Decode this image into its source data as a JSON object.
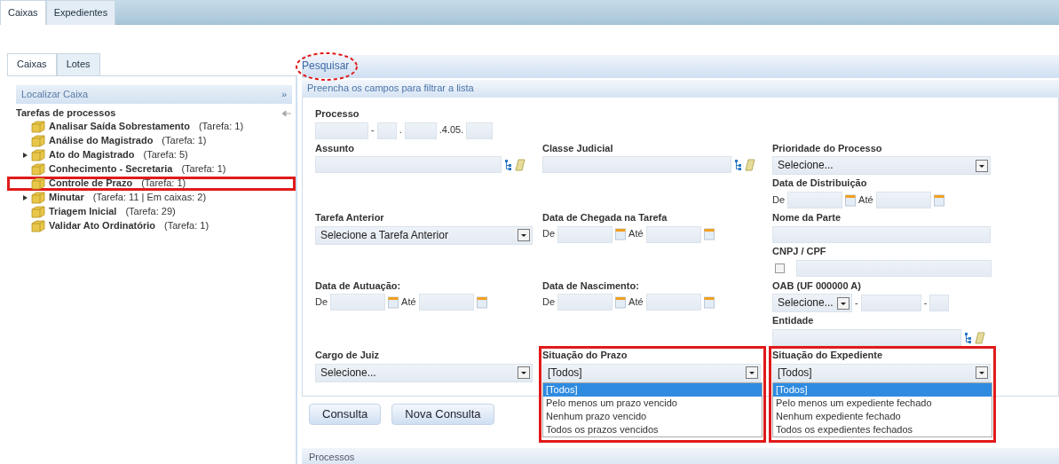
{
  "top_tabs": [
    {
      "label": "Caixas",
      "selected": true
    },
    {
      "label": "Expedientes",
      "selected": false
    }
  ],
  "sidebar": {
    "tabs": [
      {
        "label": "Caixas",
        "selected": true
      },
      {
        "label": "Lotes",
        "selected": false
      }
    ],
    "search_bar": {
      "label": "Localizar Caixa",
      "chevron": "»"
    },
    "tree": {
      "title": "Tarefas de processos",
      "items": [
        {
          "name": "Analisar Saída Sobrestamento",
          "count": "(Tarefa: 1)",
          "expandable": false,
          "highlighted": false
        },
        {
          "name": "Análise do Magistrado",
          "count": "(Tarefa: 1)",
          "expandable": false,
          "highlighted": false
        },
        {
          "name": "Ato do Magistrado",
          "count": "(Tarefa: 5)",
          "expandable": true,
          "highlighted": false
        },
        {
          "name": "Conhecimento - Secretaria",
          "count": "(Tarefa: 1)",
          "expandable": false,
          "highlighted": false
        },
        {
          "name": "Controle de Prazo",
          "count": "(Tarefa: 1)",
          "expandable": false,
          "highlighted": true
        },
        {
          "name": "Minutar",
          "count": "(Tarefa: 11 | Em caixas: 2)",
          "expandable": true,
          "highlighted": false
        },
        {
          "name": "Triagem Inicial",
          "count": "(Tarefa: 29)",
          "expandable": false,
          "highlighted": false
        },
        {
          "name": "Validar Ato Ordinatório",
          "count": "(Tarefa: 1)",
          "expandable": false,
          "highlighted": false
        }
      ]
    }
  },
  "search": {
    "title": "Pesquisar",
    "circled": true,
    "subtitle": "Preencha os campos para filtrar a lista",
    "rows": [
      [
        [
          {
            "kind": "processo",
            "label": "Processo",
            "separators": [
              "-",
              ".",
              ".4.05."
            ],
            "highlighted": false
          }
        ],
        [],
        []
      ],
      [
        [
          {
            "kind": "lookup",
            "label": "Assunto",
            "highlighted": false
          }
        ],
        [
          {
            "kind": "lookup",
            "label": "Classe Judicial",
            "highlighted": false
          }
        ],
        [
          {
            "kind": "select",
            "label": "Prioridade do Processo",
            "value": "Selecione...",
            "highlighted": false
          },
          {
            "kind": "daterange",
            "label": "Data de Distribuição",
            "from": "De",
            "to": "Até",
            "highlighted": false
          }
        ]
      ],
      [
        [
          {
            "kind": "select",
            "label": "Tarefa Anterior",
            "value": "Selecione a Tarefa Anterior",
            "highlighted": false
          }
        ],
        [
          {
            "kind": "daterange",
            "label": "Data de Chegada na Tarefa",
            "from": "De",
            "to": "Até",
            "highlighted": false
          }
        ],
        [
          {
            "kind": "text",
            "label": "Nome da Parte",
            "highlighted": false
          },
          {
            "kind": "cnpj",
            "label": "CNPJ / CPF",
            "checked": false,
            "highlighted": false
          }
        ]
      ],
      [
        [
          {
            "kind": "daterange",
            "label": "Data de Autuação:",
            "from": "De",
            "to": "Até",
            "highlighted": false
          }
        ],
        [
          {
            "kind": "daterange",
            "label": "Data de Nascimento:",
            "from": "De",
            "to": "Até",
            "highlighted": false
          }
        ],
        [
          {
            "kind": "oab",
            "label": "OAB (UF 000000 A)",
            "value": "Selecione...",
            "separators": [
              "-",
              "-"
            ],
            "highlighted": false
          },
          {
            "kind": "lookup",
            "label": "Entidade",
            "highlighted": false
          }
        ]
      ],
      [
        [
          {
            "kind": "select",
            "label": "Cargo de Juiz",
            "value": "Selecione...",
            "highlighted": false
          }
        ],
        [
          {
            "kind": "select",
            "label": "Situação do Prazo",
            "value": "[Todos]",
            "highlighted": true,
            "options": [
              {
                "label": "[Todos]",
                "selected": true
              },
              {
                "label": "Pelo menos um prazo vencido",
                "selected": false
              },
              {
                "label": "Nenhum prazo vencido",
                "selected": false
              },
              {
                "label": "Todos os prazos vencidos",
                "selected": false
              }
            ]
          }
        ],
        [
          {
            "kind": "select",
            "label": "Situação do Expediente",
            "value": "[Todos]",
            "highlighted": true,
            "options": [
              {
                "label": "[Todos]",
                "selected": true
              },
              {
                "label": "Pelo menos um expediente fechado",
                "selected": false
              },
              {
                "label": "Nenhum expediente fechado",
                "selected": false
              },
              {
                "label": "Todos os expedientes fechados",
                "selected": false
              }
            ]
          }
        ]
      ]
    ],
    "buttons": [
      "Consulta",
      "Nova Consulta"
    ]
  },
  "results": {
    "title": "Processos"
  }
}
